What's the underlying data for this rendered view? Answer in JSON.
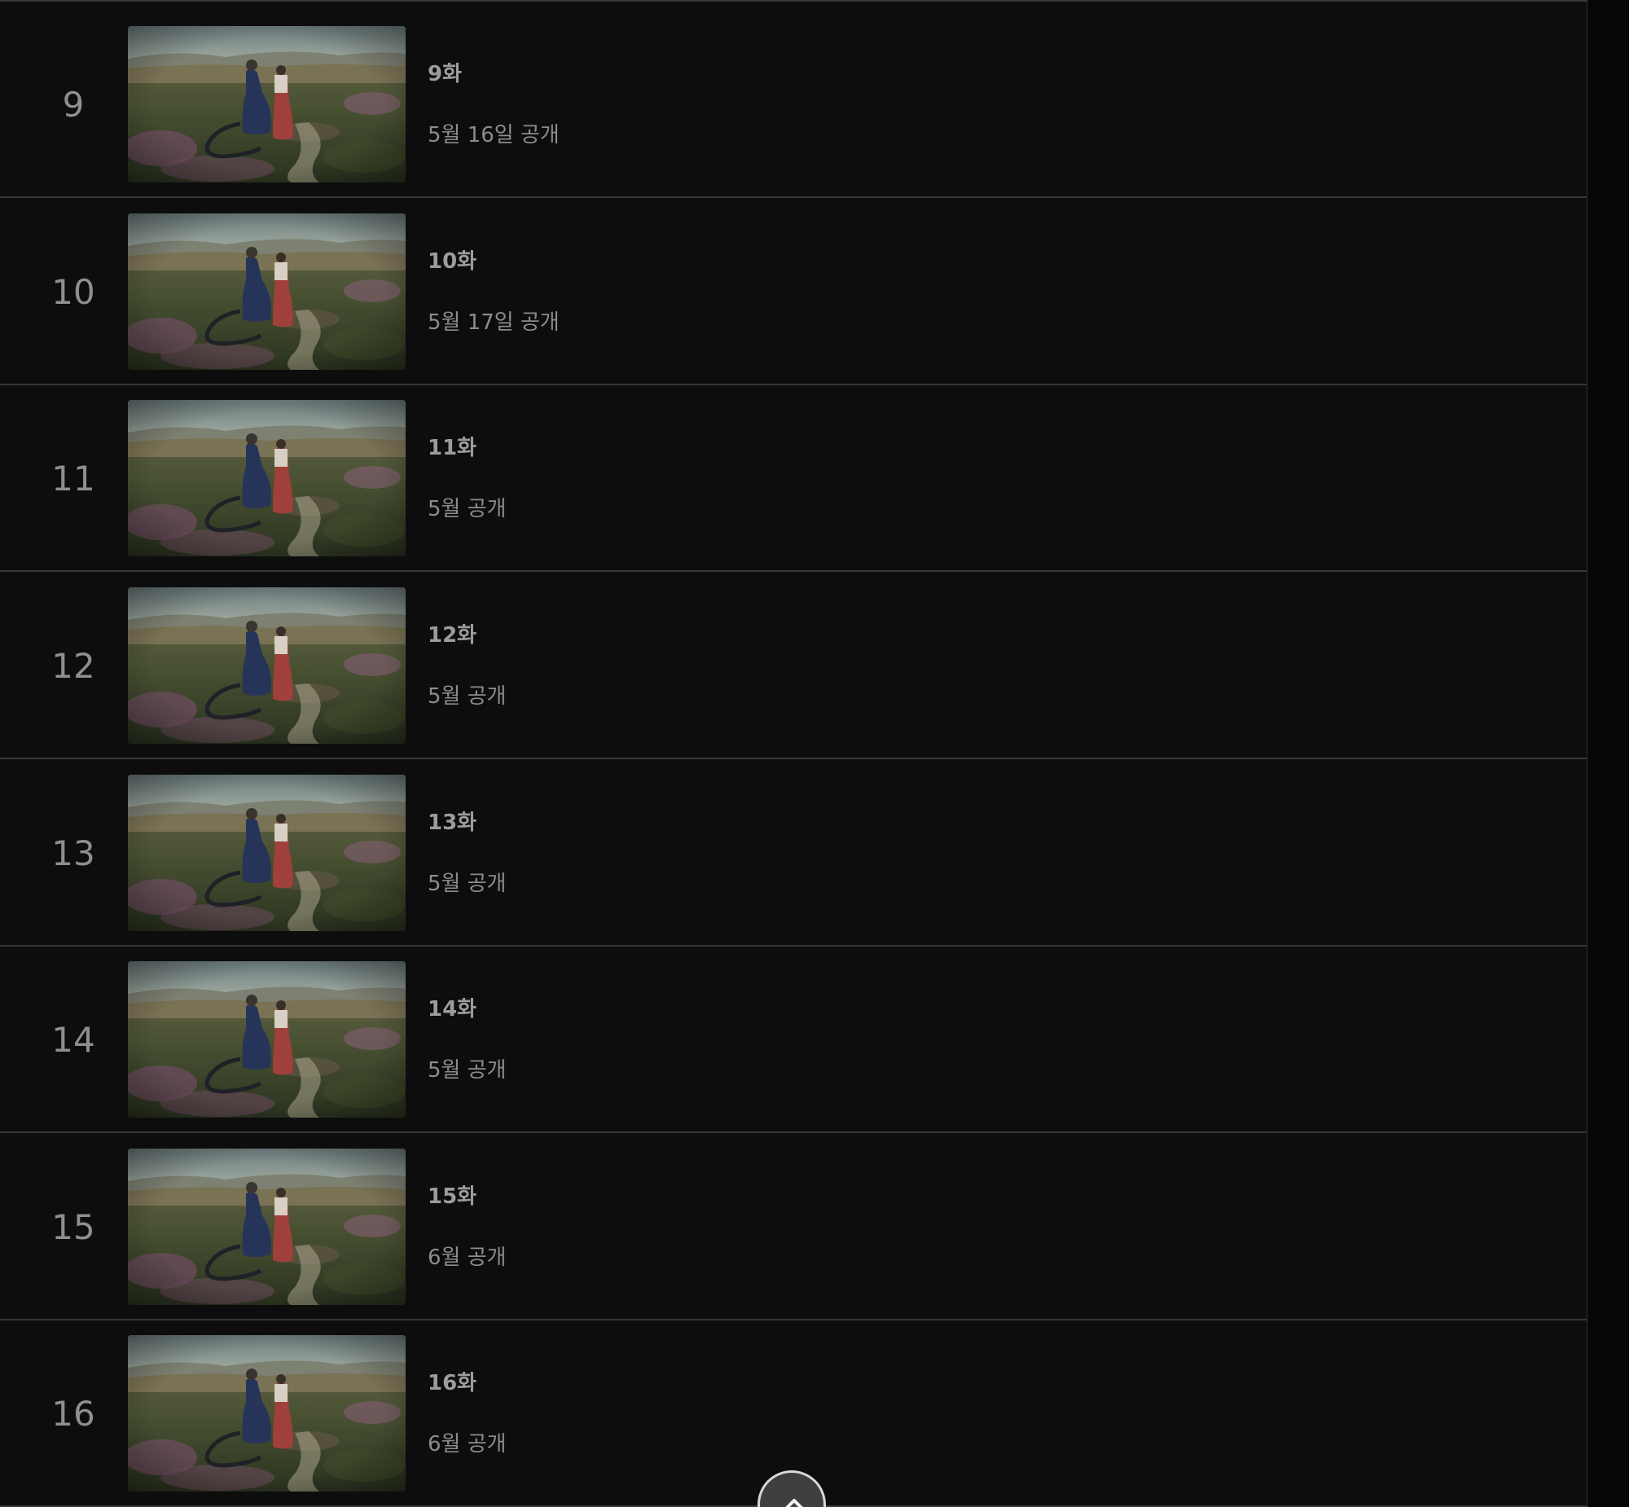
{
  "episodes": [
    {
      "number": "9",
      "title": "9화",
      "release": "5월 16일 공개"
    },
    {
      "number": "10",
      "title": "10화",
      "release": "5월 17일 공개"
    },
    {
      "number": "11",
      "title": "11화",
      "release": "5월 공개"
    },
    {
      "number": "12",
      "title": "12화",
      "release": "5월 공개"
    },
    {
      "number": "13",
      "title": "13화",
      "release": "5월 공개"
    },
    {
      "number": "14",
      "title": "14화",
      "release": "5월 공개"
    },
    {
      "number": "15",
      "title": "15화",
      "release": "6월 공개"
    },
    {
      "number": "16",
      "title": "16화",
      "release": "6월 공개"
    }
  ],
  "thumbnail": {
    "icon": "episode-thumbnail-image",
    "scene": "two figures in hanbok standing in a flowering meadow"
  },
  "scroll_top": {
    "icon": "chevron-up-icon"
  },
  "colors": {
    "background": "#0d0d0d",
    "divider": "#363636",
    "text": "#9c9c9c"
  }
}
